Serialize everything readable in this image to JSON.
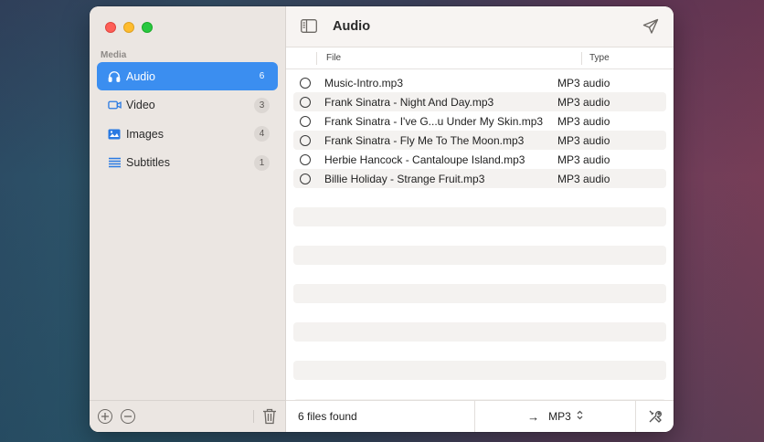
{
  "sidebar": {
    "section_label": "Media",
    "items": [
      {
        "label": "Audio",
        "count": "6",
        "icon": "headphones-icon",
        "active": true
      },
      {
        "label": "Video",
        "count": "3",
        "icon": "video-camera-icon",
        "active": false
      },
      {
        "label": "Images",
        "count": "4",
        "icon": "photo-icon",
        "active": false
      },
      {
        "label": "Subtitles",
        "count": "1",
        "icon": "text-lines-icon",
        "active": false
      }
    ]
  },
  "toolbar": {
    "title": "Audio"
  },
  "table": {
    "headers": {
      "file": "File",
      "type": "Type"
    },
    "rows": [
      {
        "file": "Music-Intro.mp3",
        "type": "MP3 audio"
      },
      {
        "file": "Frank Sinatra - Night And Day.mp3",
        "type": "MP3 audio"
      },
      {
        "file": "Frank Sinatra - I've G...u Under My Skin.mp3",
        "type": "MP3 audio"
      },
      {
        "file": "Frank Sinatra - Fly Me To The Moon.mp3",
        "type": "MP3 audio"
      },
      {
        "file": "Herbie Hancock - Cantaloupe Island.mp3",
        "type": "MP3 audio"
      },
      {
        "file": "Billie Holiday - Strange Fruit.mp3",
        "type": "MP3 audio"
      }
    ]
  },
  "status": {
    "files_found": "6 files found",
    "format": "MP3",
    "arrow": "→"
  },
  "colors": {
    "accent": "#3b8ef0",
    "sidebar_bg": "#ebe6e2"
  }
}
